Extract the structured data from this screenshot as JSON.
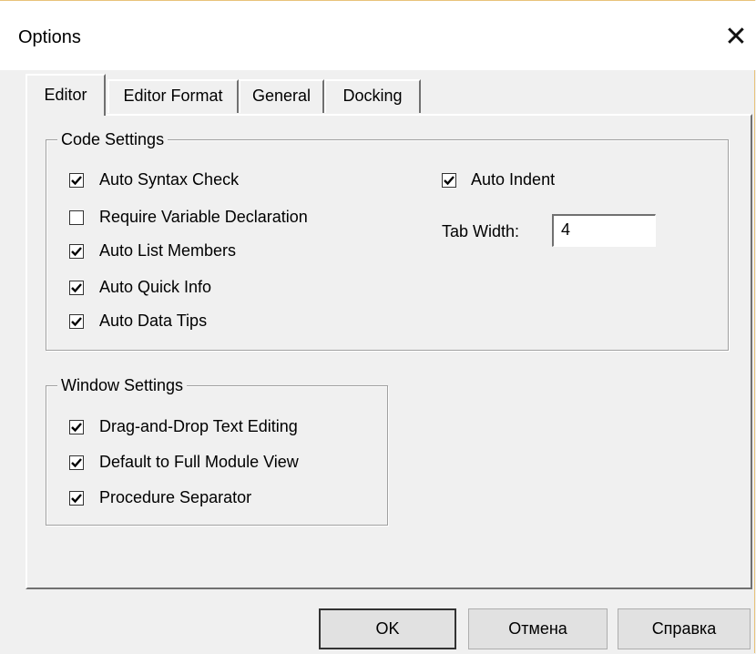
{
  "window": {
    "title": "Options"
  },
  "tabs": [
    {
      "label": "Editor",
      "active": true
    },
    {
      "label": "Editor Format",
      "active": false
    },
    {
      "label": "General",
      "active": false
    },
    {
      "label": "Docking",
      "active": false
    }
  ],
  "code_settings": {
    "legend": "Code Settings",
    "options": [
      {
        "label": "Auto Syntax Check",
        "checked": true
      },
      {
        "label": "Require Variable Declaration",
        "checked": false
      },
      {
        "label": "Auto List Members",
        "checked": true
      },
      {
        "label": "Auto Quick Info",
        "checked": true
      },
      {
        "label": "Auto Data Tips",
        "checked": true
      }
    ],
    "auto_indent": {
      "label": "Auto Indent",
      "checked": true
    },
    "tab_width": {
      "label": "Tab Width:",
      "value": "4"
    }
  },
  "window_settings": {
    "legend": "Window Settings",
    "options": [
      {
        "label": "Drag-and-Drop Text Editing",
        "checked": true
      },
      {
        "label": "Default to Full Module View",
        "checked": true
      },
      {
        "label": "Procedure Separator",
        "checked": true
      }
    ]
  },
  "buttons": {
    "ok": "OK",
    "cancel": "Отмена",
    "help": "Справка"
  }
}
